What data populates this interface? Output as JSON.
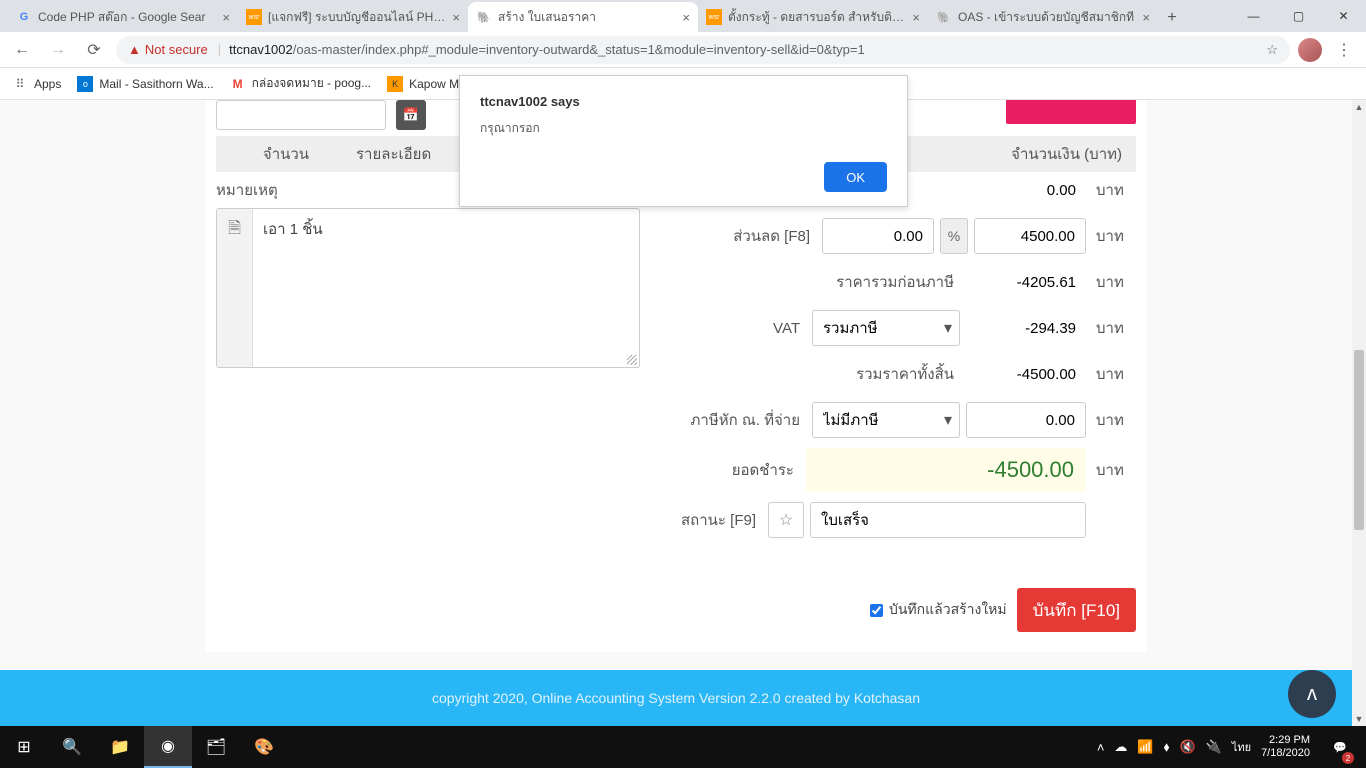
{
  "tabs": [
    {
      "title": "Code PHP สต๊อก - Google Sear",
      "favicon": "G"
    },
    {
      "title": "[แจกฟรี] ระบบบัญชีออนไลน์ PHP C",
      "favicon": "wsr"
    },
    {
      "title": "สร้าง ใบเสนอราคา",
      "favicon": "🐘",
      "active": true
    },
    {
      "title": "ตั้งกระทู้ - ดยสารบอร์ด สำหรับติดต่",
      "favicon": "wsr"
    },
    {
      "title": "OAS - เข้าระบบด้วยบัญชีสมาชิกที",
      "favicon": "🐘"
    }
  ],
  "address": {
    "not_secure": "Not secure",
    "host": "ttcnav1002",
    "path": "/oas-master/index.php#_module=inventory-outward&_status=1&module=inventory-sell&id=0&typ=1"
  },
  "bookmarks": [
    {
      "label": "Apps",
      "icon": "⠿"
    },
    {
      "label": "Mail - Sasithorn Wa...",
      "icon": "📧"
    },
    {
      "label": "กล่องจดหมาย - poog...",
      "icon": "M"
    },
    {
      "label": "Kapow M",
      "icon": "🔧"
    }
  ],
  "dialog": {
    "title": "ttcnav1002 says",
    "message": "กรุณากรอก",
    "ok": "OK"
  },
  "headers": {
    "qty": "จำนวน",
    "detail": "รายละเอียด",
    "amount": "จำนวนเงิน (บาท)"
  },
  "remark": {
    "label": "หมายเหตุ",
    "text": "เอา 1 ชิ้น"
  },
  "form": {
    "line_total": "0.00",
    "discount_label": "ส่วนลด [F8]",
    "discount": "0.00",
    "percent": "%",
    "discount_amt": "4500.00",
    "subtotal_label": "ราคารวมก่อนภาษี",
    "subtotal": "-4205.61",
    "vat_label": "VAT",
    "vat_option": "รวมภาษี",
    "vat_amt": "-294.39",
    "grand_label": "รวมราคาทั้งสิ้น",
    "grand": "-4500.00",
    "wht_label": "ภาษีหัก ณ. ที่จ่าย",
    "wht_option": "ไม่มีภาษี",
    "wht_amt": "0.00",
    "balance_label": "ยอดชำระ",
    "balance": "-4500.00",
    "status_label": "สถานะ [F9]",
    "status_value": "ใบเสร็จ",
    "save_new_label": "บันทึกแล้วสร้างใหม่",
    "save_btn": "บันทึก [F10]",
    "unit": "บาท"
  },
  "footer": "copyright 2020, Online Accounting System Version 2.2.0 created by Kotchasan",
  "tray": {
    "lang": "ไทย",
    "time": "2:29 PM",
    "date": "7/18/2020",
    "notif_count": "2"
  }
}
